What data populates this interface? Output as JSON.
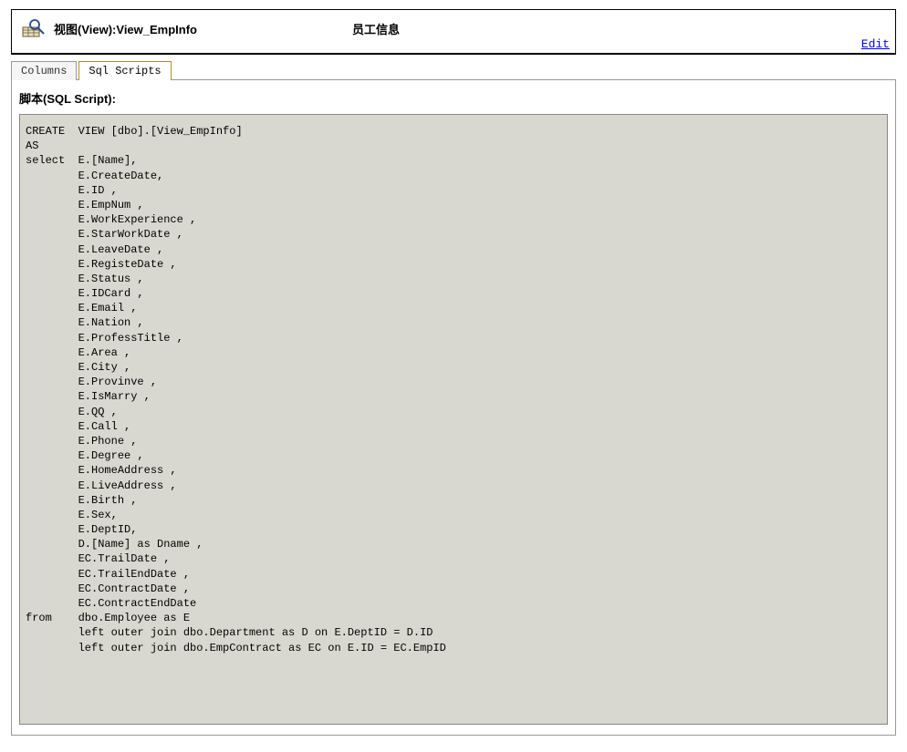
{
  "header": {
    "title": "视图(View):View_EmpInfo",
    "subtitle": "员工信息",
    "edit_link": "Edit"
  },
  "tabs": {
    "columns": "Columns",
    "sql_scripts": "Sql Scripts"
  },
  "script_section": {
    "label": "脚本(SQL Script):",
    "sql": "CREATE  VIEW [dbo].[View_EmpInfo]\nAS \nselect  E.[Name],\n        E.CreateDate,\n        E.ID ,\n        E.EmpNum ,\n        E.WorkExperience ,\n        E.StarWorkDate ,\n        E.LeaveDate ,\n        E.RegisteDate ,\n        E.Status ,\n        E.IDCard ,\n        E.Email ,\n        E.Nation ,\n        E.ProfessTitle ,\n        E.Area ,\n        E.City ,\n        E.Provinve ,\n        E.IsMarry ,\n        E.QQ ,\n        E.Call ,\n        E.Phone ,\n        E.Degree ,\n        E.HomeAddress ,\n        E.LiveAddress ,\n        E.Birth ,\n        E.Sex,\n        E.DeptID,\n        D.[Name] as Dname ,\n        EC.TrailDate ,\n        EC.TrailEndDate ,\n        EC.ContractDate ,\n        EC.ContractEndDate\nfrom    dbo.Employee as E\n        left outer join dbo.Department as D on E.DeptID = D.ID\n        left outer join dbo.EmpContract as EC on E.ID = EC.EmpID"
  }
}
